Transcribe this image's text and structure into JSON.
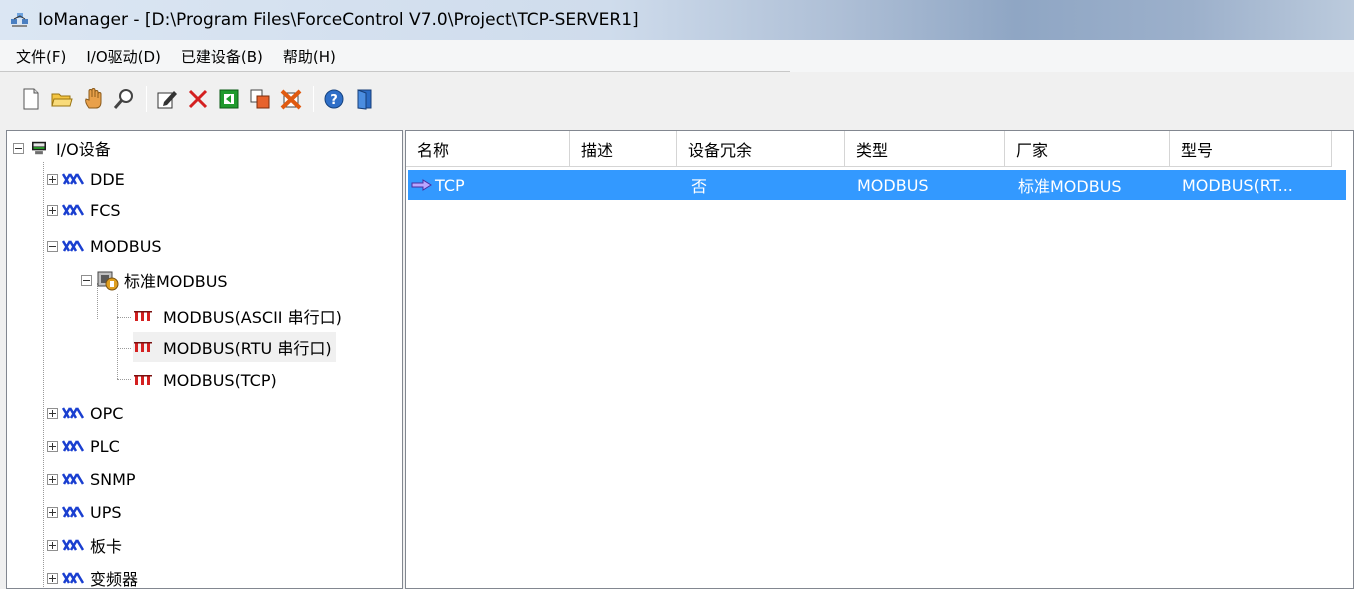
{
  "window": {
    "title": "IoManager - [D:\\Program Files\\ForceControl V7.0\\Project\\TCP-SERVER1]"
  },
  "menu": [
    "文件(F)",
    "I/O驱动(D)",
    "已建设备(B)",
    "帮助(H)"
  ],
  "toolbar": [
    "new-icon",
    "open-folder-icon",
    "hand-icon",
    "find-icon",
    "edit-icon",
    "delete-icon",
    "green-square-icon",
    "copy-icon",
    "delete-all-icon",
    "help-icon",
    "exit-icon"
  ],
  "tree": {
    "root": "I/O设备",
    "dde": "DDE",
    "fcs": "FCS",
    "modbus": "MODBUS",
    "std_modbus": "标准MODBUS",
    "modbus_ascii": "MODBUS(ASCII 串行口)",
    "modbus_rtu": "MODBUS(RTU 串行口)",
    "modbus_tcp": "MODBUS(TCP)",
    "opc": "OPC",
    "plc": "PLC",
    "snmp": "SNMP",
    "ups": "UPS",
    "board": "板卡",
    "inverter": "变频器"
  },
  "list": {
    "columns": [
      "名称",
      "描述",
      "设备冗余",
      "类型",
      "厂家",
      "型号"
    ],
    "rows": [
      {
        "name": "TCP",
        "desc": "",
        "redundant": "否",
        "type": "MODBUS",
        "vendor": "标准MODBUS",
        "model": "MODBUS(RT..."
      }
    ]
  },
  "colors": {
    "selection": "#3399ff",
    "net_icon": "#1a3fd0"
  }
}
